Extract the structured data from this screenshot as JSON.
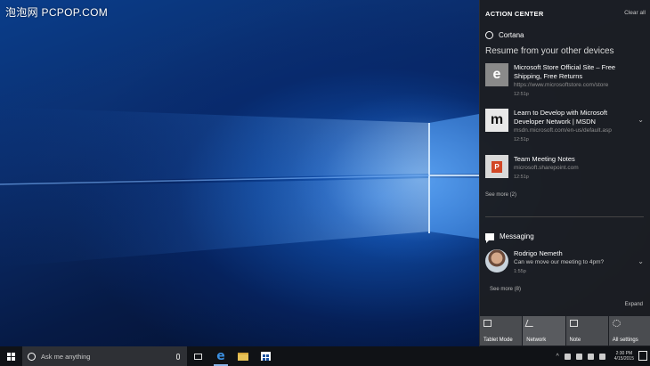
{
  "watermark": "泡泡网 PCPOP.COM",
  "action_center": {
    "title": "ACTION CENTER",
    "clear_all": "Clear all",
    "cortana": {
      "app_name": "Cortana",
      "heading": "Resume from your other devices",
      "items": [
        {
          "icon": "edge-icon",
          "glyph": "e",
          "title": "Microsoft Store Official Site – Free Shipping, Free Returns",
          "url": "https://www.microsoftstore.com/store",
          "time": "12:51p"
        },
        {
          "icon": "msdn-icon",
          "glyph": "m",
          "title": "Learn to Develop with Microsoft Developer Network | MSDN",
          "url": "msdn.microsoft.com/en-us/default.asp",
          "time": "12:51p"
        },
        {
          "icon": "powerpoint-icon",
          "glyph": "P",
          "title": "Team Meeting Notes",
          "url": "microsoft.sharepoint.com",
          "time": "12:51p"
        }
      ],
      "see_more": "See more (2)"
    },
    "messaging": {
      "app_name": "Messaging",
      "sender": "Rodrigo Nemeth",
      "message": "Can we move our meeting to 4pm?",
      "time": "1:55p",
      "see_more": "See more (8)"
    },
    "expand": "Expand",
    "quick_actions": [
      {
        "label": "Tablet Mode",
        "icon": "tablet-icon"
      },
      {
        "label": "Network",
        "icon": "network-icon"
      },
      {
        "label": "Note",
        "icon": "note-icon"
      },
      {
        "label": "All settings",
        "icon": "settings-icon"
      }
    ]
  },
  "taskbar": {
    "search_placeholder": "Ask me anything",
    "time": "2:30 PM",
    "date": "4/15/2015"
  },
  "colors": {
    "accent": "#3b8fe0",
    "action_center_bg": "#1c1e22",
    "tile": "#4a4c50"
  }
}
